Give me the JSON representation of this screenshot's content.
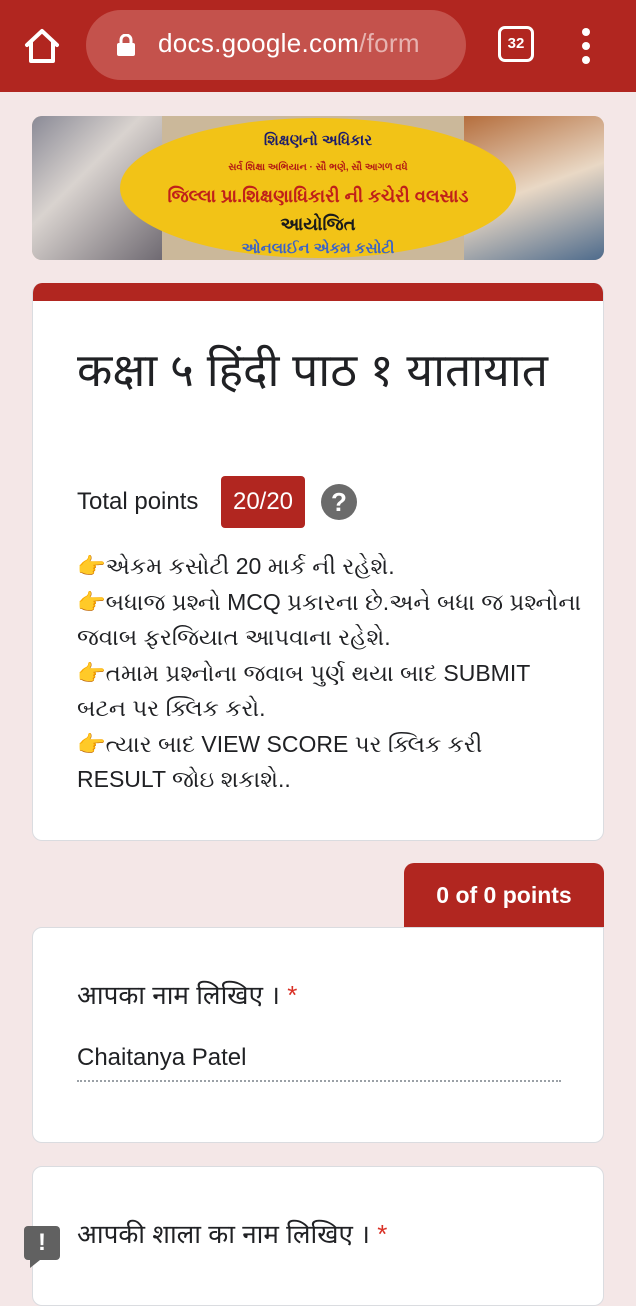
{
  "browser": {
    "url_domain": "docs.google.com",
    "url_path": "/form",
    "tab_count": "32",
    "icons": {
      "home": "home-icon",
      "lock": "lock-icon",
      "menu": "more-vert-icon"
    }
  },
  "banner": {
    "line1": "શિક્ષણનો અધિકાર",
    "line2": "સર્વ શિક્ષા અભિયાન · સૌ ભણે, સૌ આગળ વધે",
    "line3": "જિલ્લા પ્રા.શિક્ષણાધિકારી ની કચેરી વલસાડ",
    "line4": "આયોજિત",
    "line5": "ઓનલાઈન એકમ કસોટી"
  },
  "form": {
    "title": "कक्षा ५ हिंदी पाठ १ यातायात",
    "total_points_label": "Total points",
    "total_points_value": "20/20",
    "help_icon": "?",
    "description_lines": [
      "👉એકમ કસોટી 20 માર્ક ની રહેશે.",
      "👉બધાજ પ્રશ્નો MCQ પ્રકારના છે.અને બધા જ પ્રશ્નોના",
      "જવાબ ફરજિયાત આપવાના રહેશે.",
      "👉તમામ પ્રશ્નોના જવાબ પુર્ણ થયા બાદ SUBMIT",
      "બટન પર ક્લિક કરો.",
      "👉ત્યાર બાદ VIEW SCORE પર ક્લિક કરી",
      "RESULT જોઇ શકાશે.."
    ]
  },
  "section_score": "0 of 0 points",
  "questions": [
    {
      "label": "आपका नाम लिखिए ।",
      "required_mark": "*",
      "answer": "Chaitanya Patel"
    },
    {
      "label": "आपकी शाला का नाम लिखिए ।",
      "required_mark": "*"
    }
  ],
  "feedback_icon": "!",
  "colors": {
    "accent": "#b12620",
    "background": "#f4e7e7",
    "required": "#d93025"
  }
}
